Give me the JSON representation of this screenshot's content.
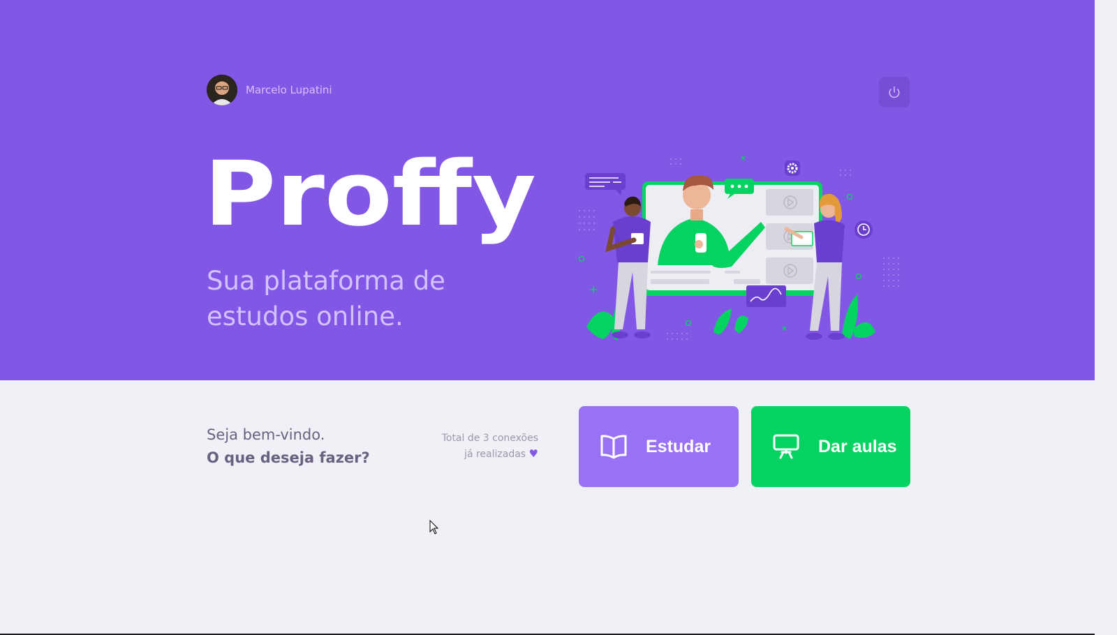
{
  "user": {
    "name": "Marcelo Lupatini"
  },
  "header": {
    "logo_text": "Proffy",
    "tagline": "Sua plataforma de estudos online."
  },
  "welcome": {
    "greeting": "Seja bem-vindo.",
    "question": "O que deseja fazer?"
  },
  "connections": {
    "line1": "Total de 3 conexões",
    "line2": "já realizadas"
  },
  "buttons": {
    "study_label": "Estudar",
    "give_classes_label": "Dar aulas"
  },
  "icons": {
    "logout": "power-icon",
    "study": "book-open-icon",
    "give_classes": "presentation-board-icon",
    "heart": "purple-heart-icon"
  },
  "colors": {
    "primary": "#8257E5",
    "primary_lighter": "#9871F5",
    "secondary": "#04D361",
    "background": "#F0F0F7",
    "text_in_primary": "#D4C2FF",
    "text_base": "#6A6180"
  }
}
